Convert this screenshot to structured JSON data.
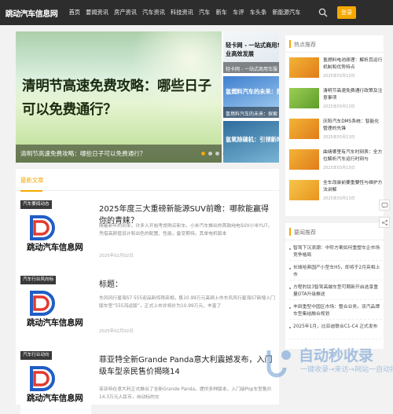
{
  "header": {
    "logo_text": "跳动汽车信息网",
    "nav": [
      "首页",
      "要闻资讯",
      "房产资讯",
      "汽车资讯",
      "科技资讯",
      "汽车",
      "新车",
      "车评",
      "车头条",
      "新能源汽车"
    ],
    "login_label": "登录"
  },
  "hero": {
    "slide_title": "清明节高速免费攻略：哪些日子可以免费通行？",
    "slide_caption": "清明节高速免费攻略：哪些日子可以免费通行？",
    "side_cards": [
      {
        "title": "轻卡网 - 一站式商用车",
        "title2": "业高效发展",
        "sub": "轻卡网 - 一站式商用车服"
      },
      {
        "title": "氢燃料汽车的未来：探",
        "sub": "氢燃料汽车的未来：探索"
      },
      {
        "title": "氢氧除碳机：引领新时代",
        "sub": ""
      }
    ]
  },
  "latest": {
    "heading": "最新文章",
    "brand_text": "跳动汽车信息网",
    "articles": [
      {
        "tag": "汽车要闻动态",
        "title": "2025年度三大重磅新能源SUV前瞻：哪款能赢得你的青睐？",
        "desc": "随着新年的到来，许多人开始考虑购买新车。小米汽车推出的首款纯电SUV小米YU7，凭借高颜值设计和出色的配置、性能，备受期待。其单电机版本",
        "date": "2025年02月02日"
      },
      {
        "tag": "汽车行业风向标",
        "title": "标题：",
        "desc": "东风风行星海S7 555迎品新惊艳亮相，售10.99万元高频上市东风风行星海S7新增入门版车型“555鸿运版”，正式上市并将价为10.99万元，丰富了",
        "date": "2025年02月02日"
      },
      {
        "tag": "汽车行业动向",
        "title": "菲亚特全新Grande Panda意大利震撼发布，入门级车型亲民售价揭晓14",
        "desc": "菲亚特在意大利正式推出了全新Grande Panda，提供多种版本，入门级Pop车型售价14.3万元人民币，自动标的交"
      },
      {
        "tag": "",
        "title": "",
        "desc": "",
        "date": ""
      }
    ]
  },
  "hot": {
    "heading": "热点推荐",
    "items": [
      {
        "title": "氢燃料电池原理：解析其运行机制和优势特点",
        "date": "2025年03月13日"
      },
      {
        "title": "清明节高速免费通行政策及注意事项",
        "date": "2025年03月13日"
      },
      {
        "title": "庆阳汽车DMS系统：智能化管理的先锋",
        "date": "2025年03月13日"
      },
      {
        "title": "曲靖哪里有汽车时刻表：全方位解析汽车运行时刻与",
        "date": "2025年03月13日"
      },
      {
        "title": "全车改装前要重要性与维护方法讲解",
        "date": "2025年03月13日"
      }
    ]
  },
  "recommend": {
    "heading": "要闻推荐",
    "items": [
      "智驾下沉浪潮：中阶方案如何重塑车企市场竞争格局",
      "长城哈弗国产小型车H5，即将于2月亮相上市",
      "方程豹钛3智驾高端车型可期新开启选享重量OTA升级推送",
      "丰田重型中国区市场：整合业务，双汽品牌车型集结融合规划",
      "2025年1月，比亚迪联合C1-C4 正式发布"
    ]
  },
  "watermark": {
    "title": "自动秒收录",
    "sub": "一键收录→来访→网站一自动排名"
  }
}
